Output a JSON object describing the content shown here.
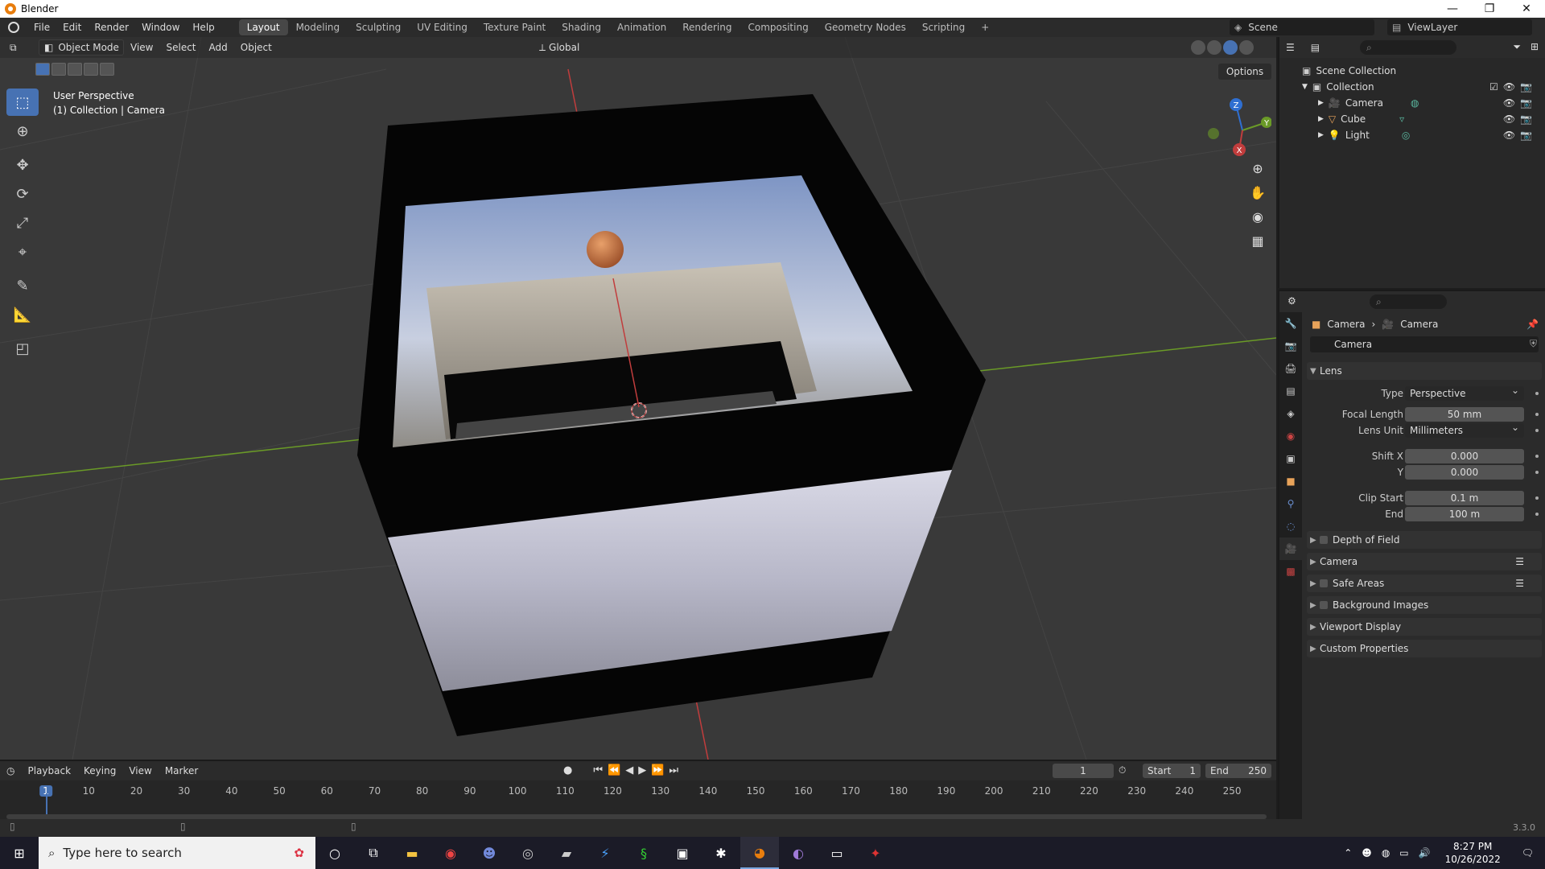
{
  "window": {
    "title": "Blender",
    "min": "—",
    "max": "❐",
    "close": "✕"
  },
  "menubar": {
    "items": [
      "File",
      "Edit",
      "Render",
      "Window",
      "Help"
    ],
    "workspaces": [
      "Layout",
      "Modeling",
      "Sculpting",
      "UV Editing",
      "Texture Paint",
      "Shading",
      "Animation",
      "Rendering",
      "Compositing",
      "Geometry Nodes",
      "Scripting"
    ],
    "add_tab": "+",
    "scene": "Scene",
    "view_layer": "ViewLayer"
  },
  "viewport": {
    "mode": "Object Mode",
    "menus": [
      "View",
      "Select",
      "Add",
      "Object"
    ],
    "orientation": "Global",
    "options": "Options",
    "info_line1": "User Perspective",
    "info_line2": "(1) Collection | Camera",
    "gizmo": {
      "z": "Z",
      "y": "Y",
      "x": "X"
    },
    "icons": [
      "select-box-icon",
      "cursor-icon",
      "move-icon",
      "rotate-icon",
      "scale-icon",
      "transform-icon",
      "annotate-icon",
      "measure-icon",
      "add-cube-icon"
    ]
  },
  "timeline": {
    "menus": [
      "Playback",
      "Keying",
      "View",
      "Marker"
    ],
    "current_frame": "1",
    "start_label": "Start",
    "start": "1",
    "end_label": "End",
    "end": "250",
    "ticks": [
      "1",
      "10",
      "20",
      "30",
      "40",
      "50",
      "60",
      "70",
      "80",
      "90",
      "100",
      "110",
      "120",
      "130",
      "140",
      "150",
      "160",
      "170",
      "180",
      "190",
      "200",
      "210",
      "220",
      "230",
      "240",
      "250"
    ]
  },
  "status": {
    "version": "3.3.0"
  },
  "outliner": {
    "search_placeholder": "",
    "scene_collection": "Scene Collection",
    "collection": "Collection",
    "objects": [
      {
        "name": "Camera",
        "color": "#e8a35a"
      },
      {
        "name": "Cube",
        "color": "#e8a35a"
      },
      {
        "name": "Light",
        "color": "#e8a35a"
      }
    ]
  },
  "properties": {
    "breadcrumb_object": "Camera",
    "breadcrumb_sep": "›",
    "breadcrumb_data": "Camera",
    "data_name": "Camera",
    "lens_panel": "Lens",
    "type_label": "Type",
    "type_value": "Perspective",
    "focal_label": "Focal Length",
    "focal_value": "50 mm",
    "lens_unit_label": "Lens Unit",
    "lens_unit_value": "Millimeters",
    "shift_x_label": "Shift X",
    "shift_x_value": "0.000",
    "shift_y_label": "Y",
    "shift_y_value": "0.000",
    "clip_start_label": "Clip Start",
    "clip_start_value": "0.1 m",
    "clip_end_label": "End",
    "clip_end_value": "100 m",
    "panels": [
      "Depth of Field",
      "Camera",
      "Safe Areas",
      "Background Images",
      "Viewport Display",
      "Custom Properties"
    ]
  },
  "taskbar": {
    "search_placeholder": "Type here to search",
    "time": "8:27 PM",
    "date": "10/26/2022",
    "apps": [
      "cortana-icon",
      "task-view-icon",
      "file-explorer-icon",
      "chrome-icon",
      "discord-icon",
      "obs-icon",
      "app-icon",
      "edge-icon",
      "app-icon",
      "app-icon",
      "app-icon",
      "blender-icon",
      "github-icon",
      "app-icon",
      "app-icon"
    ]
  },
  "colors": {
    "accent": "#4772b3",
    "viewport_bg": "#393939",
    "axis_x": "#c13d3d",
    "axis_y": "#6a9a27"
  }
}
